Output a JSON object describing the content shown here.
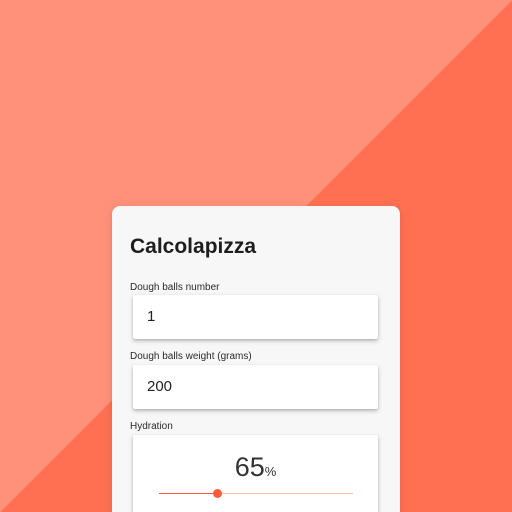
{
  "app": {
    "title": "Calcolapizza"
  },
  "fields": {
    "dough_balls_number": {
      "label": "Dough balls number",
      "value": "1"
    },
    "dough_balls_weight": {
      "label": "Dough balls weight (grams)",
      "value": "200"
    },
    "hydration": {
      "label": "Hydration",
      "value": "65",
      "unit": "%",
      "slider_fraction": 0.3
    }
  },
  "colors": {
    "background_light": "#FF917A",
    "background_dark": "#FF7052",
    "accent": "#FF5B3A",
    "card": "#F7F7F7"
  }
}
